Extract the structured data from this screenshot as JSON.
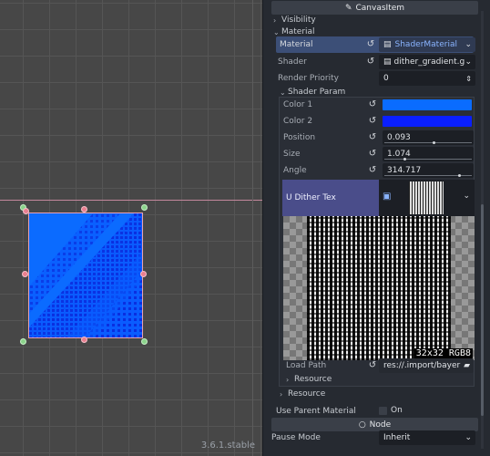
{
  "viewport": {
    "version_text": "3.6.1.stable",
    "sprite_color": "#0a5cff"
  },
  "inspector": {
    "canvasitem_header": "CanvasItem",
    "visibility_label": "Visibility",
    "material_section_label": "Material",
    "material": {
      "label": "Material",
      "value": "ShaderMaterial"
    },
    "shader": {
      "label": "Shader",
      "value": "dither_gradient.g"
    },
    "render_priority": {
      "label": "Render Priority",
      "value": "0"
    },
    "shader_param_label": "Shader Param",
    "params": {
      "color1_label": "Color 1",
      "color1_value": "#0a6cff",
      "color2_label": "Color 2",
      "color2_value": "#0a1fff",
      "position_label": "Position",
      "position_value": "0.093",
      "position_fraction": 0.093,
      "size_label": "Size",
      "size_value": "1.074",
      "angle_label": "Angle",
      "angle_value": "314.717"
    },
    "dither_tex": {
      "label": "U Dither Tex",
      "badge": "32x32 RGB8",
      "load_path_label": "Load Path",
      "load_path_value": "res://.import/bayer",
      "resource_label": "Resource"
    },
    "resource_label": "Resource",
    "use_parent_material": {
      "label": "Use Parent Material",
      "value": "On"
    },
    "node_header": "Node",
    "pause_mode": {
      "label": "Pause Mode",
      "value": "Inherit"
    }
  }
}
